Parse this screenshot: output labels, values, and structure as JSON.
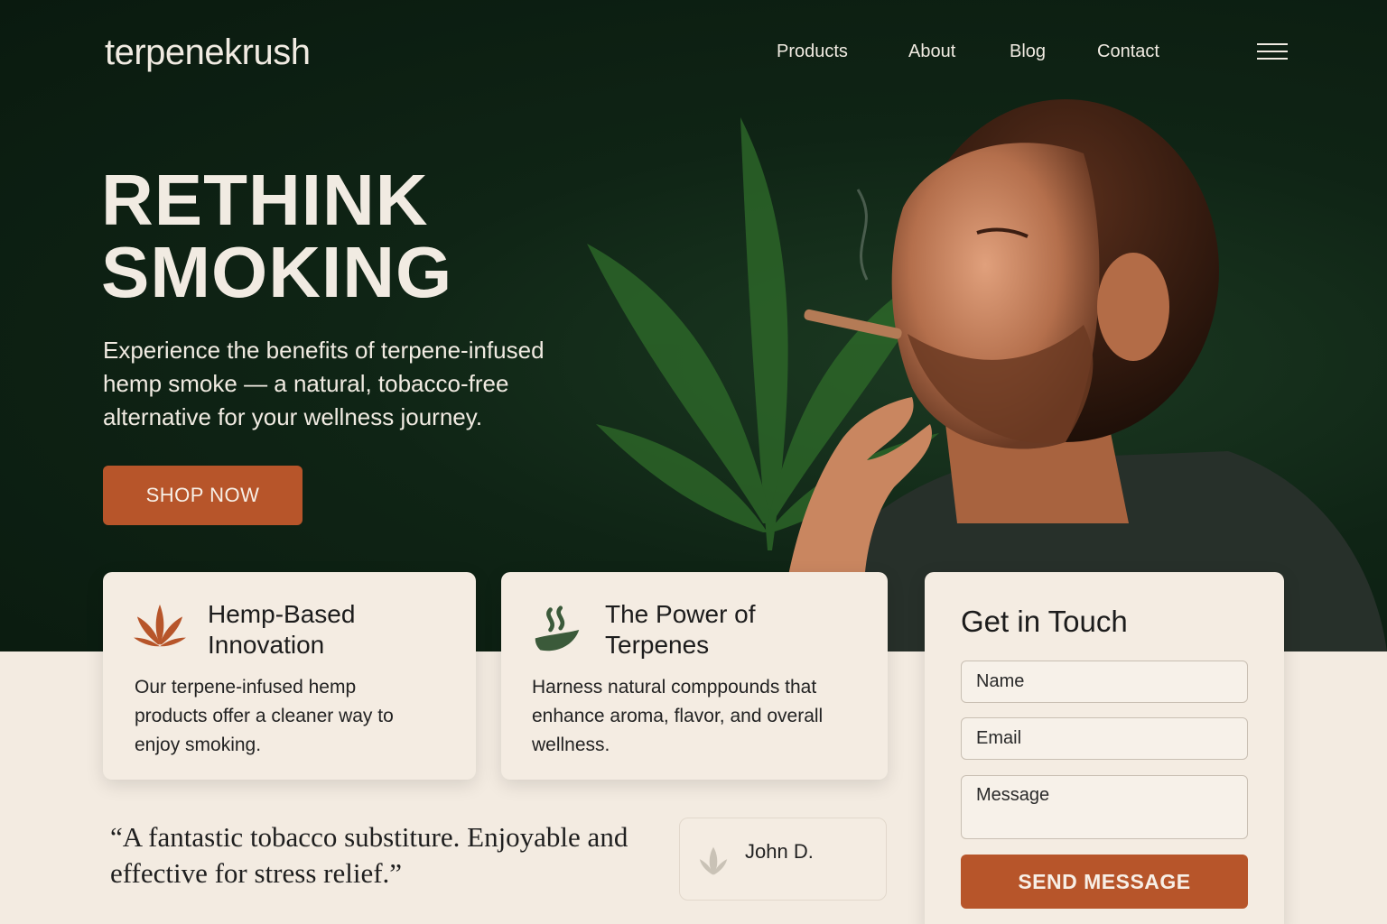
{
  "brand": {
    "logo_text": "terpenekrush"
  },
  "nav": {
    "items": [
      {
        "label": "Products"
      },
      {
        "label": "About"
      },
      {
        "label": "Blog"
      },
      {
        "label": "Contact"
      }
    ],
    "menu_icon": "hamburger-menu-icon"
  },
  "hero": {
    "title_line1": "RETHINK",
    "title_line2": "SMOKING",
    "subtitle": "Experience the benefits of terpene-infused hemp smoke — a natural, tobacco-free alternative for your wellness journey.",
    "cta_label": "SHOP NOW"
  },
  "features": [
    {
      "icon": "hemp-leaf-icon",
      "title_line1": "Hemp-Based",
      "title_line2": "Innovation",
      "text": "Our terpene-infused hemp products offer a cleaner way to enjoy smoking."
    },
    {
      "icon": "terpene-steam-icon",
      "title_line1": "The Power of",
      "title_line2": "Terpenes",
      "text": "Harness natural comppounds that enhance aroma, flavor, and overall wellness."
    }
  ],
  "contact": {
    "heading": "Get in Touch",
    "name_placeholder": "Name",
    "email_placeholder": "Email",
    "message_placeholder": "Message",
    "send_label": "SEND MESSAGE"
  },
  "testimonial": {
    "quote": "“A fantastic tobacco substiture. Enjoyable and effective for stress relief.”",
    "author": "John D.",
    "author_icon": "leaf-icon"
  },
  "colors": {
    "hero_bg": "#0f2415",
    "accent": "#b7552a",
    "cream": "#f3ebe1",
    "card_bg": "#f4ece2"
  }
}
